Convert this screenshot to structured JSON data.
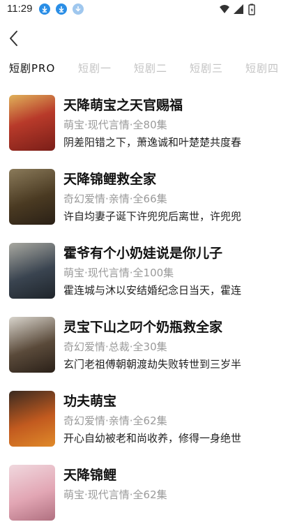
{
  "status_bar": {
    "time": "11:29",
    "icons": [
      "download-icon",
      "download-icon",
      "download-icon",
      "wifi-icon",
      "signal-icon",
      "battery-icon"
    ]
  },
  "nav": {
    "back_icon": "chevron-left-icon"
  },
  "tabs": [
    {
      "label": "短剧PRO",
      "active": true
    },
    {
      "label": "短剧一",
      "active": false
    },
    {
      "label": "短剧二",
      "active": false
    },
    {
      "label": "短剧三",
      "active": false
    },
    {
      "label": "短剧四",
      "active": false
    }
  ],
  "items": [
    {
      "title": "天降萌宝之天官赐福",
      "meta": "萌宝·现代言情·全80集",
      "desc": "阴差阳错之下，萧逸诚和叶楚楚共度春",
      "cover_color": "#b83a2a"
    },
    {
      "title": "天降锦鲤救全家",
      "meta": "奇幻爱情·亲情·全66集",
      "desc": "许自均妻子诞下许兜兜后离世，许兜兜",
      "cover_color": "#4a3a22"
    },
    {
      "title": "霍爷有个小奶娃说是你儿子",
      "meta": "萌宝·现代言情·全100集",
      "desc": "霍连城与沐以安结婚纪念日当天，霍连",
      "cover_color": "#3a4450"
    },
    {
      "title": "灵宝下山之叼个奶瓶救全家",
      "meta": "奇幻爱情·总裁·全30集",
      "desc": "玄门老祖傅朝朝渡劫失败转世到三岁半",
      "cover_color": "#5a4a3a"
    },
    {
      "title": "功夫萌宝",
      "meta": "奇幻爱情·亲情·全62集",
      "desc": "开心自幼被老和尚收养，修得一身绝世",
      "cover_color": "#c25a1f"
    },
    {
      "title": "天降锦鲤",
      "meta": "萌宝·现代言情·全62集",
      "desc": "",
      "cover_color": "#e2a6b4"
    }
  ]
}
